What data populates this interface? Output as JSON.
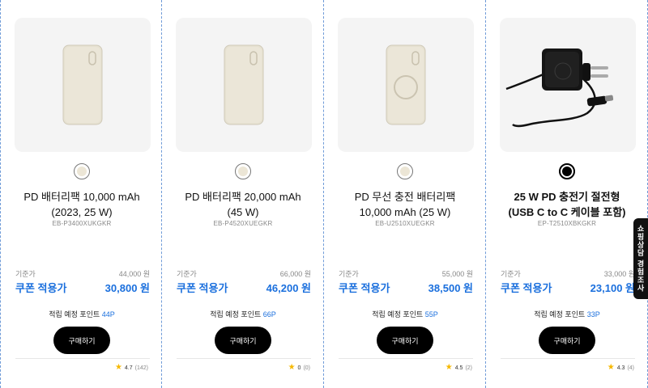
{
  "products": [
    {
      "name_line1": "PD 배터리팩 10,000 mAh",
      "name_line2": "(2023, 25 W)",
      "sku": "EB-P3400XUKGKR",
      "base_label": "기준가",
      "base_price": "44,000 원",
      "coupon_label": "쿠폰 적용가",
      "coupon_price": "30,800 원",
      "points_prefix": "적립 예정 포인트",
      "points": "44P",
      "buy_label": "구매하기",
      "rating": "4.7",
      "review_count": "(142)",
      "swatch_color": "#ece6d6",
      "image": "powerbank-icon"
    },
    {
      "name_line1": "PD 배터리팩 20,000 mAh",
      "name_line2": "(45 W)",
      "sku": "EB-P4520XUEGKR",
      "base_label": "기준가",
      "base_price": "66,000 원",
      "coupon_label": "쿠폰 적용가",
      "coupon_price": "46,200 원",
      "points_prefix": "적립 예정 포인트",
      "points": "66P",
      "buy_label": "구매하기",
      "rating": "0",
      "review_count": "(0)",
      "swatch_color": "#ece6d6",
      "image": "powerbank-icon"
    },
    {
      "name_line1": "PD 무선 충전 배터리팩",
      "name_line2": "10,000 mAh (25 W)",
      "sku": "EB-U2510XUEGKR",
      "base_label": "기준가",
      "base_price": "55,000 원",
      "coupon_label": "쿠폰 적용가",
      "coupon_price": "38,500 원",
      "points_prefix": "적립 예정 포인트",
      "points": "55P",
      "buy_label": "구매하기",
      "rating": "4.5",
      "review_count": "(2)",
      "swatch_color": "#ece6d6",
      "image": "wireless-powerbank-icon"
    },
    {
      "name_line1": "25 W PD 충전기 절전형",
      "name_line2": "(USB C to C 케이블 포함)",
      "sku": "EP-T2510XBKGKR",
      "base_label": "기준가",
      "base_price": "33,000 원",
      "coupon_label": "쿠폰 적용가",
      "coupon_price": "23,100 원",
      "points_prefix": "적립 예정 포인트",
      "points": "33P",
      "buy_label": "구매하기",
      "rating": "4.3",
      "review_count": "(4)",
      "swatch_color": "#000000",
      "image": "charger-icon"
    }
  ],
  "survey_tab": "쇼핑상담 경험조사",
  "colors": {
    "accent": "#1a6fdd",
    "button": "#000000",
    "star": "#f6b800"
  }
}
